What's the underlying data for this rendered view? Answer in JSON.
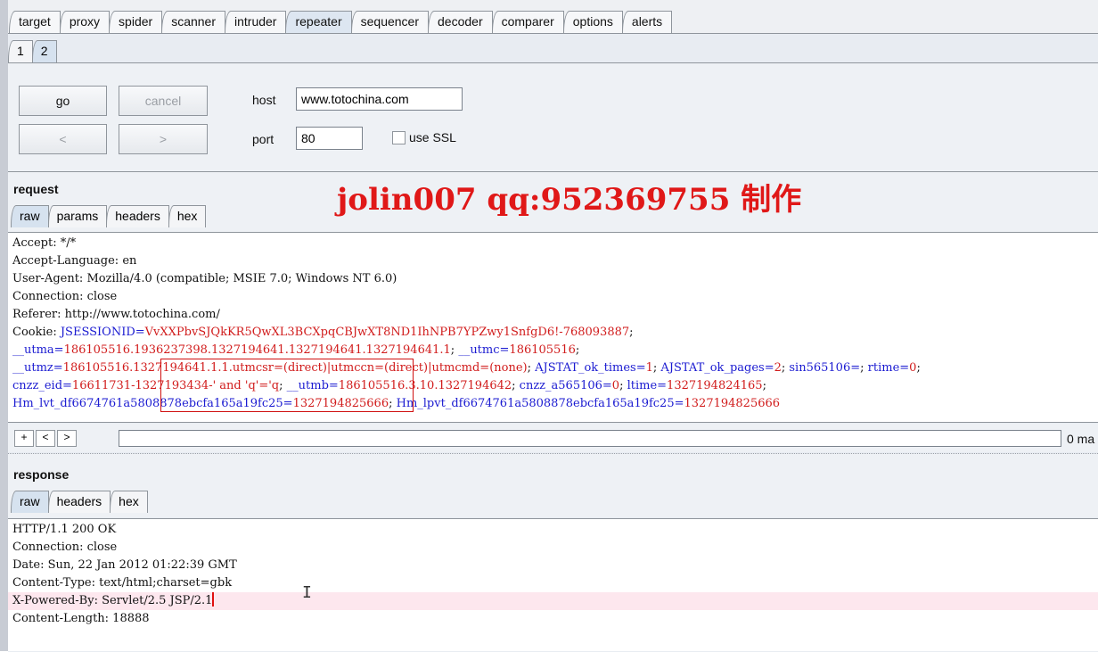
{
  "top_tabs": [
    "target",
    "proxy",
    "spider",
    "scanner",
    "intruder",
    "repeater",
    "sequencer",
    "decoder",
    "comparer",
    "options",
    "alerts"
  ],
  "active_top_tab": "repeater",
  "sub_tabs": [
    "1",
    "2"
  ],
  "active_sub_tab": "2",
  "controls": {
    "go": "go",
    "cancel": "cancel",
    "back": "<",
    "forward": ">",
    "host_label": "host",
    "host_value": "www.totochina.com",
    "port_label": "port",
    "port_value": "80",
    "ssl_label": "use SSL"
  },
  "watermark": "jolin007 qq:952369755 制作",
  "request": {
    "title": "request",
    "tabs": [
      "raw",
      "params",
      "headers",
      "hex"
    ],
    "lines": [
      {
        "key": "Accept: ",
        "val": "*/*",
        "kc": "k",
        "vc": "k"
      },
      {
        "key": "Accept-Language: ",
        "val": "en",
        "kc": "k",
        "vc": "k"
      },
      {
        "key": "User-Agent: ",
        "val": "Mozilla/4.0 (compatible; MSIE 7.0; Windows NT 6.0)",
        "kc": "k",
        "vc": "k"
      },
      {
        "key": "Connection: ",
        "val": "close",
        "kc": "k",
        "vc": "k"
      },
      {
        "key": "Referer: ",
        "val": "http://www.totochina.com/",
        "kc": "k",
        "vc": "k"
      },
      {
        "key": "Cookie: ",
        "val": "JSESSIONID=VvXXPbvSJQkKR5QwXL3BCXpqCBJwXT8ND1IhNPB7YPZwy1SnfgD6!-768093887;",
        "kc": "k",
        "vc": "mix1"
      },
      {
        "key": "",
        "val": "__utma=186105516.1936237398.1327194641.1327194641.1327194641.1; __utmc=186105516;",
        "kc": "k",
        "vc": "mix"
      },
      {
        "key": "",
        "val": "__utmz=186105516.1327194641.1.1.utmcsr=(direct)|utmccn=(direct)|utmcmd=(none); AJSTAT_ok_times=1; AJSTAT_ok_pages=2; sin565106=; rtime=0;",
        "kc": "k",
        "vc": "mix"
      },
      {
        "key": "",
        "val": "cnzz_eid=16611731-1327193434-' and 'q'='q; __utmb=186105516.3.10.1327194642; cnzz_a565106=0; ltime=1327194824165;",
        "kc": "k",
        "vc": "mix"
      },
      {
        "key": "",
        "val": "Hm_lvt_df6674761a5808878ebcfa165a19fc25=1327194825666; Hm_lpvt_df6674761a5808878ebcfa165a19fc25=1327194825666",
        "kc": "k",
        "vc": "mix"
      }
    ]
  },
  "nav": {
    "plus": "+",
    "prev": "<",
    "next": ">",
    "search_value": "",
    "matches": "0 ma"
  },
  "response": {
    "title": "response",
    "tabs": [
      "raw",
      "headers",
      "hex"
    ],
    "lines": [
      "HTTP/1.1 200 OK",
      "Connection: close",
      "Date: Sun, 22 Jan 2012 01:22:39 GMT",
      "Content-Type: text/html;charset=gbk",
      "X-Powered-By: Servlet/2.5 JSP/2.1",
      "Content-Length: 18888"
    ]
  }
}
